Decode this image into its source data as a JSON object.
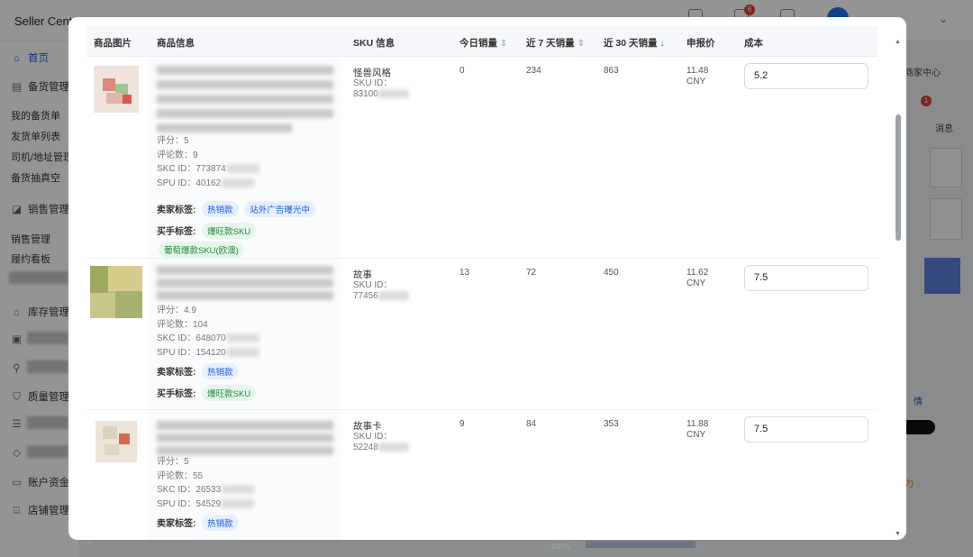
{
  "app": {
    "title": "Seller Cent",
    "notification_count": "6"
  },
  "sidebar": {
    "home": "首页",
    "stock_mgmt": "备货管理",
    "my_stock_orders": "我的备货单",
    "shipment_list": "发货单列表",
    "driver_address": "司机/地址管理",
    "stock_sampling": "备货抽真空",
    "sales_mgmt": "销售管理",
    "sales_manage": "销售管理",
    "fulfillment_board": "履约看板",
    "inventory_mgmt": "库存管理",
    "quality_mgmt": "质量管理",
    "account_funds": "账户资金",
    "store_mgmt": "店铺管理"
  },
  "background_right": {
    "merchant_center": "商家中心",
    "messages": "消息",
    "message_count": "1",
    "details_text": "情",
    "side_text": "力"
  },
  "table": {
    "headers": {
      "image": "商品图片",
      "info": "商品信息",
      "sku": "SKU 信息",
      "today": "今日销量",
      "week": "近 7 天销量",
      "month": "近 30 天销量",
      "price": "申报价",
      "cost": "成本"
    },
    "rows": [
      {
        "rating": "评分：5",
        "reviews": "评论数：9",
        "skc": "SKC ID：773874",
        "spu": "SPU ID：40162",
        "seller_label": "卖家标签:",
        "seller_tags": [
          "热销款",
          "站外广告曝光中"
        ],
        "buyer_label": "买手标签:",
        "buyer_tags": [
          "爆旺款SKU"
        ],
        "extra_tag": "葡萄爆款SKU(欧澳)",
        "sku_name": "怪兽风格",
        "sku_id_label": "SKU ID：",
        "sku_id": "83100",
        "today": "0",
        "week": "234",
        "month": "863",
        "price": "11.48",
        "currency": "CNY",
        "cost": "5.2"
      },
      {
        "rating": "评分：4.9",
        "reviews": "评论数：104",
        "skc": "SKC ID：648070",
        "spu": "SPU ID：154120",
        "seller_label": "卖家标签:",
        "seller_tags": [
          "热销款"
        ],
        "buyer_label": "买手标签:",
        "buyer_tags": [
          "爆旺款SKU"
        ],
        "sku_name": "故事",
        "sku_id_label": "SKU ID：",
        "sku_id": "77456",
        "today": "13",
        "week": "72",
        "month": "450",
        "price": "11.62",
        "currency": "CNY",
        "cost": "7.5"
      },
      {
        "rating": "评分：5",
        "reviews": "评论数：55",
        "skc": "SKC ID：26533",
        "spu": "SPU ID：54529",
        "seller_label": "卖家标签:",
        "seller_tags": [
          "热销款"
        ],
        "sku_name": "故事卡",
        "sku_id_label": "SKU ID：",
        "sku_id": "52248",
        "today": "9",
        "week": "84",
        "month": "353",
        "price": "11.88",
        "currency": "CNY",
        "cost": "7.5"
      }
    ]
  },
  "footer": {
    "zoom": "100%"
  },
  "colors": {
    "accent": "#1a5cd8",
    "tag_blue_bg": "#e6efff",
    "tag_green_bg": "#e5f6ea",
    "tag_green": "#1f8a3e"
  }
}
